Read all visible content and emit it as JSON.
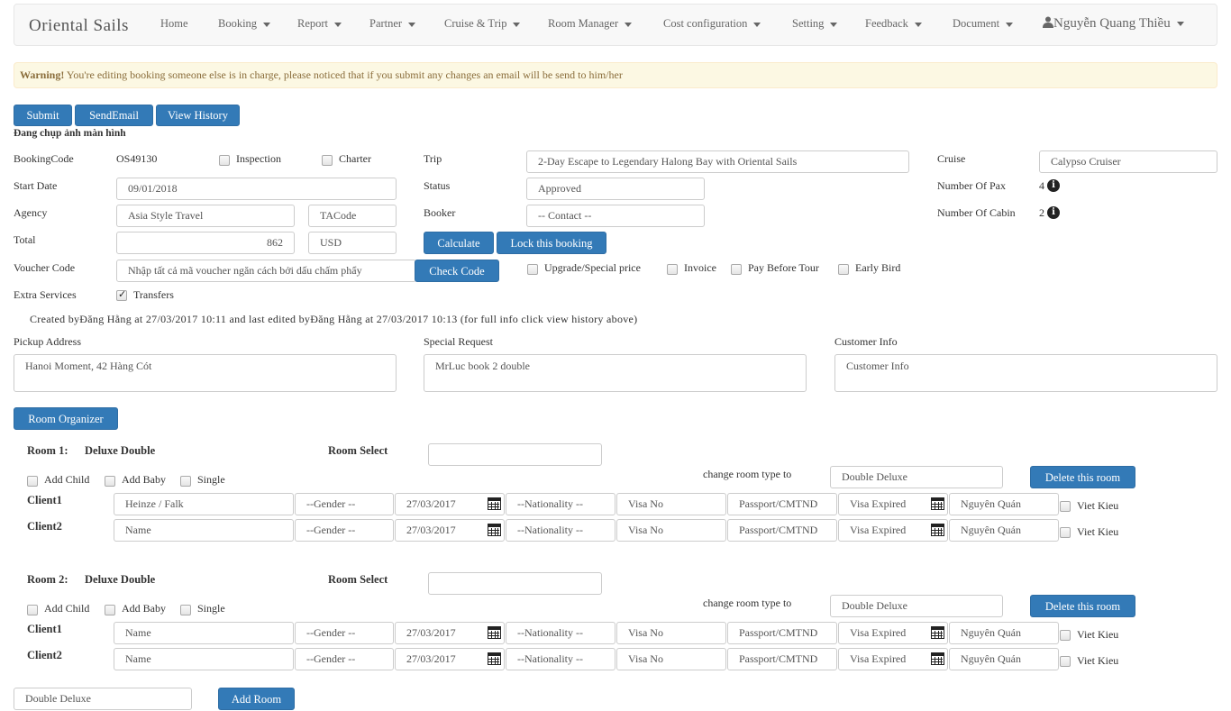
{
  "nav": {
    "brand": "Oriental  Sails",
    "items": [
      {
        "label": "Home",
        "caret": false
      },
      {
        "label": "Booking",
        "caret": true
      },
      {
        "label": "Report",
        "caret": true
      },
      {
        "label": "Partner",
        "caret": true
      },
      {
        "label": "Cruise   & Trip",
        "caret": true
      },
      {
        "label": "Room   Manager",
        "caret": true
      },
      {
        "label": "Cost  configuration",
        "caret": true
      },
      {
        "label": "Setting",
        "caret": true
      },
      {
        "label": "Feedback",
        "caret": true
      },
      {
        "label": "Document",
        "caret": true
      }
    ],
    "user": "Nguyễn Quang Thiều"
  },
  "alert": {
    "strong": "Warning!",
    "text": " You're  editing  booking  someone   else   is  in charge,   please   noticed  that if you submit  any changes    an  email  will be  send   to him/her"
  },
  "actions": {
    "submit": "Submit",
    "send_email": "SendEmail",
    "view_history": "View  History"
  },
  "status_line": "Đang chụp ảnh màn hình",
  "form": {
    "booking_code_label": "BookingCode",
    "booking_code": "OS49130",
    "inspection_label": "Inspection",
    "charter_label": "Charter",
    "trip_label": "Trip",
    "trip_value": "2-Day Escape    to Legendary   Halong   Bay with Oriental  Sails",
    "cruise_label": "Cruise",
    "cruise_value": "Calypso  Cruiser",
    "start_date_label": "Start Date",
    "start_date": "09/01/2018",
    "status_label": "Status",
    "status_value": "Approved",
    "pax_label": "Number   Of Pax",
    "pax_value": "4",
    "agency_label": "Agency",
    "agency_value": "Asia Style Travel",
    "tacode_placeholder": "TACode",
    "booker_label": "Booker",
    "booker_value": "-- Contact  --",
    "cabin_label": "Number   Of Cabin",
    "cabin_value": "2",
    "total_label": "Total",
    "total_value": "862",
    "currency": "USD",
    "calculate": "Calculate",
    "lock": "Lock  this booking",
    "voucher_label": "Voucher   Code",
    "voucher_placeholder": "Nhập tất cả mã voucher ngăn cách bởi dấu chấm phẩy",
    "check_code": "Check   Code",
    "upgrade_label": "Upgrade/Special      price",
    "invoice_label": "Invoice",
    "pay_before_label": "Pay Before  Tour",
    "early_bird_label": "Early Bird",
    "extra_label": "Extra Services",
    "transfers_label": "Transfers",
    "created_note": "Created byĐăng Hằng at 27/03/2017 10:11 and last edited byĐăng Hằng at 27/03/2017 10:13 (for full info click view history above)",
    "pickup_label": "Pickup  Address",
    "pickup_value": "Hanoi  Moment,  42 Hàng  Cót",
    "special_label": "Special   Request",
    "special_value": "MrLuc book  2 double",
    "customer_label": "Customer    Info",
    "customer_placeholder": "Customer    Info"
  },
  "room_organizer": "Room  Organizer",
  "rooms": [
    {
      "title": "Room  1:",
      "type": "Deluxe Double",
      "select_label": "Room  Select",
      "add_child": "Add Child",
      "add_baby": "Add Baby",
      "single": "Single",
      "change_label": "change     room   type to",
      "change_value": "Double  Deluxe",
      "delete": "Delete   this room",
      "clients": [
        {
          "label": "Client1",
          "name": "Heinze   / Falk",
          "gender": "--Gender --",
          "dob": "27/03/2017",
          "nationality": "--Nationality --",
          "visa": "Visa  No",
          "passport": "Passport/CMTND",
          "visa_expired": "Visa  Expired",
          "hometown": "Nguyên  Quán",
          "viet_kieu": "Viet Kieu"
        },
        {
          "label": "Client2",
          "name": "Name",
          "gender": "--Gender --",
          "dob": "27/03/2017",
          "nationality": "--Nationality --",
          "visa": "Visa  No",
          "passport": "Passport/CMTND",
          "visa_expired": "Visa  Expired",
          "hometown": "Nguyên  Quán",
          "viet_kieu": "Viet Kieu"
        }
      ]
    },
    {
      "title": "Room  2:",
      "type": "Deluxe Double",
      "select_label": "Room  Select",
      "add_child": "Add Child",
      "add_baby": "Add Baby",
      "single": "Single",
      "change_label": "change     room   type to",
      "change_value": "Double  Deluxe",
      "delete": "Delete   this room",
      "clients": [
        {
          "label": "Client1",
          "name": "Name",
          "gender": "--Gender --",
          "dob": "27/03/2017",
          "nationality": "--Nationality --",
          "visa": "Visa  No",
          "passport": "Passport/CMTND",
          "visa_expired": "Visa  Expired",
          "hometown": "Nguyên  Quán",
          "viet_kieu": "Viet Kieu"
        },
        {
          "label": "Client2",
          "name": "Name",
          "gender": "--Gender --",
          "dob": "27/03/2017",
          "nationality": "--Nationality --",
          "visa": "Visa  No",
          "passport": "Passport/CMTND",
          "visa_expired": "Visa  Expired",
          "hometown": "Nguyên  Quán",
          "viet_kieu": "Viet Kieu"
        }
      ]
    }
  ],
  "add_room": {
    "type_value": "Double  Deluxe",
    "button": "Add Room"
  }
}
